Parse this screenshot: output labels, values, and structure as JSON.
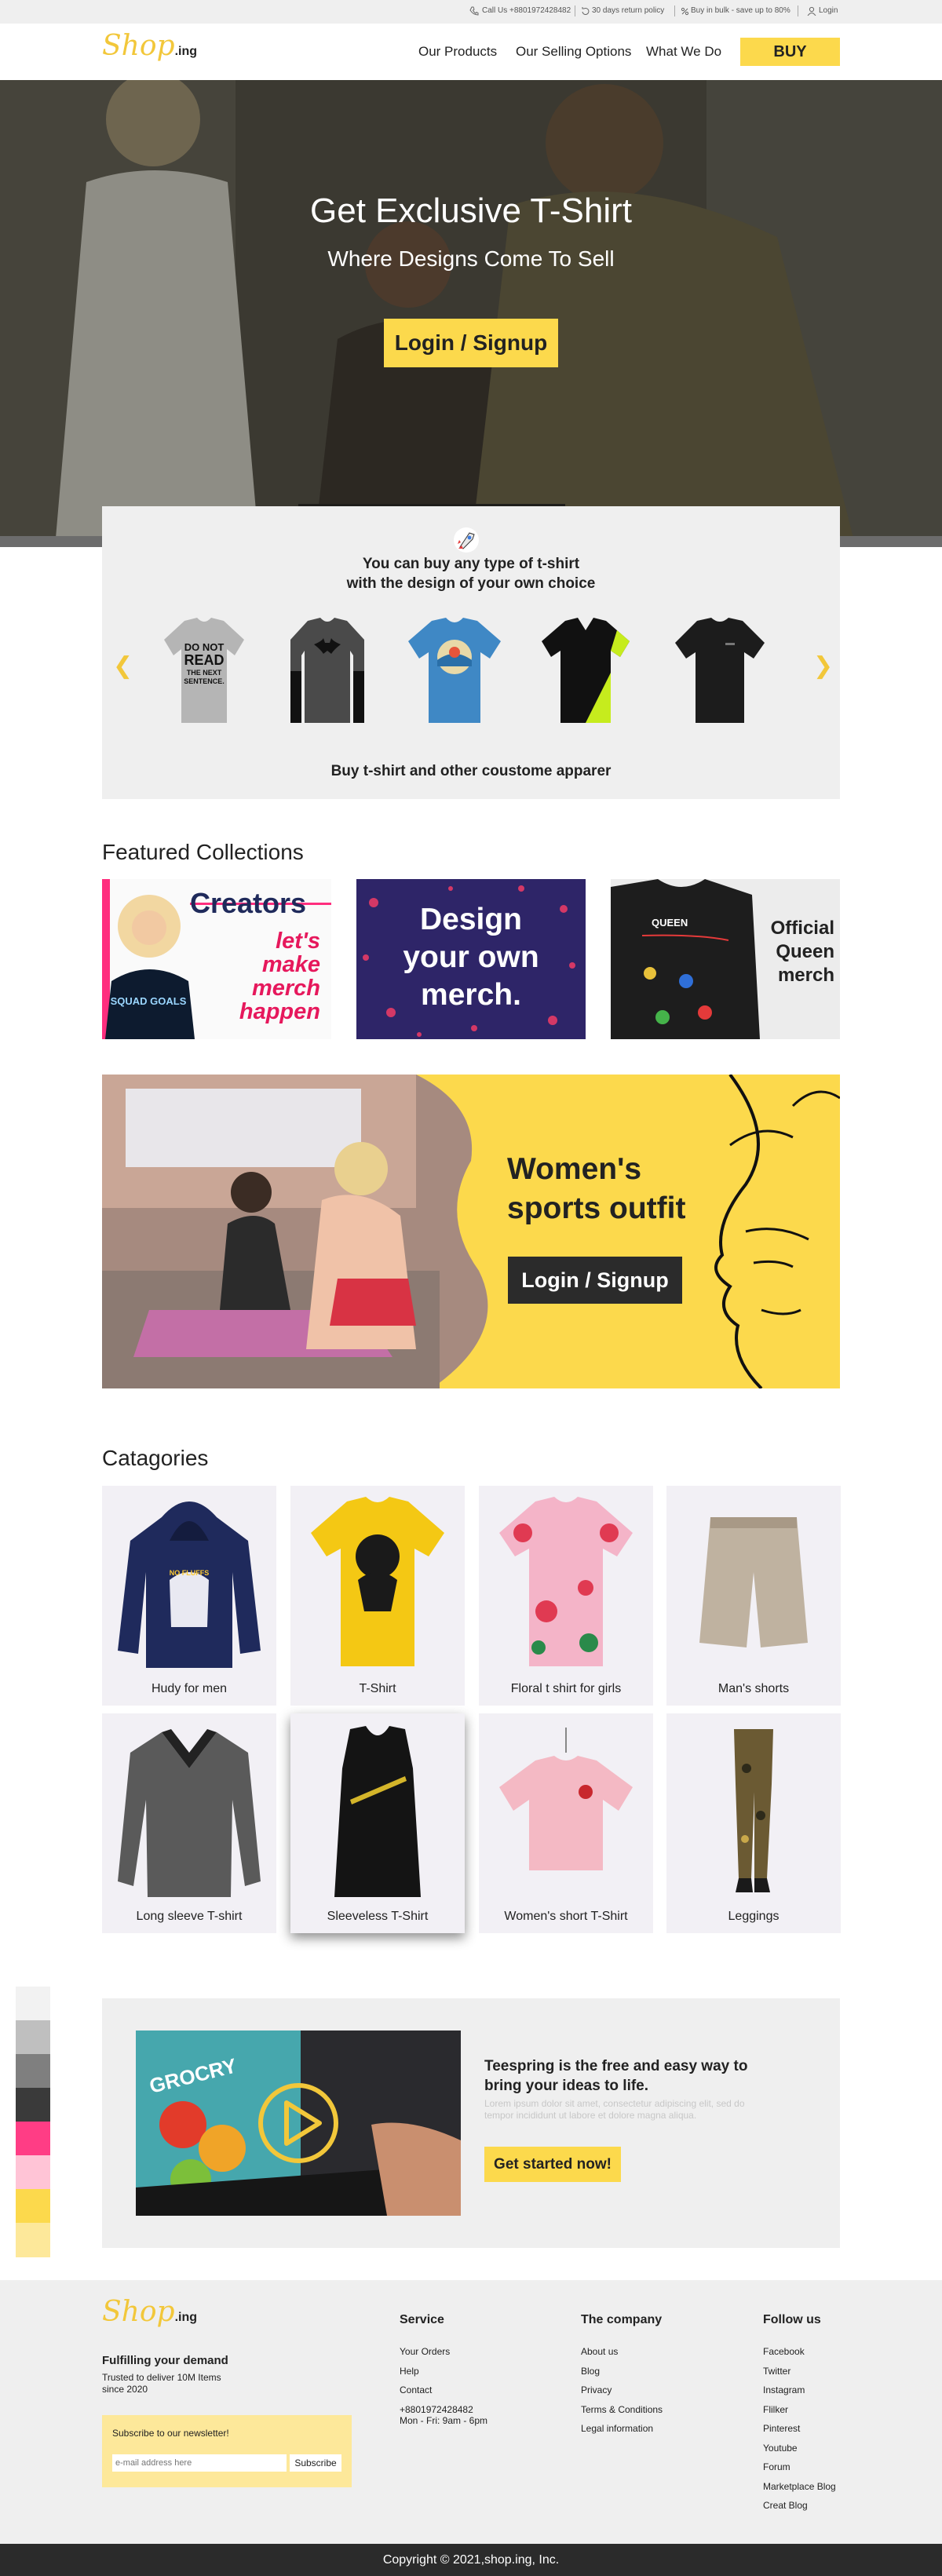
{
  "topbar": {
    "call": "Call Us +8801972428482",
    "returns": "30 days return policy",
    "bulk": "Buy in bulk - save up to 80%",
    "login": "Login"
  },
  "brand": {
    "logo_script": "Shop",
    "logo_suffix": ".ing"
  },
  "nav": {
    "items": [
      "Our Products",
      "Our Selling Options",
      "What We Do"
    ],
    "buy": "BUY"
  },
  "hero": {
    "title": "Get Exclusive T-Shirt",
    "subtitle": "Where Designs Come To Sell",
    "cta": "Login / Signup"
  },
  "showcase": {
    "line1": "You can buy any type of t-shirt",
    "line2": "with the design of your own choice",
    "tee1_text": "DO NOT READ THE NEXT SENTENCE.",
    "caption": "Buy t-shirt and other coustome apparer"
  },
  "featured": {
    "title": "Featured Collections",
    "card1": {
      "heading": "Creators",
      "l1": "let's",
      "l2": "make",
      "l3": "merch",
      "l4": "happen",
      "shirt": "SQUAD GOALS"
    },
    "card2": {
      "l1": "Design",
      "l2": "your own",
      "l3": "merch."
    },
    "card3": {
      "l1": "Official",
      "l2": "Queen",
      "l3": "merch",
      "shirt": "QUEEN"
    }
  },
  "promo": {
    "l1": "Women's",
    "l2": "sports outfit",
    "cta": "Login / Signup"
  },
  "categories": {
    "title": "Catagories",
    "items": [
      "Hudy for men",
      "T-Shirt",
      "Floral t shirt for girls",
      "Man's shorts",
      "Long sleeve T-shirt",
      "Sleeveless T-Shirt",
      "Women's short T-Shirt",
      "Leggings"
    ]
  },
  "video": {
    "thumb_text": "GROCRY",
    "heading1": "Teespring is the free and easy way to",
    "heading2": "bring your ideas to life.",
    "body1": "Lorem ipsum dolor sit amet, consectetur adipiscing elit, sed do",
    "body2": "tempor incididunt ut labore et dolore magna aliqua.",
    "cta": "Get started now!"
  },
  "swatches": [
    "#f2f2f2",
    "#bfbfbf",
    "#7f7f7f",
    "#3a3a3a",
    "#ff3d85",
    "#ffc4d6",
    "#fcd94c",
    "#fde89a"
  ],
  "footer": {
    "tagline": "Fulfilling your demand",
    "sub1": "Trusted to deliver 10M Items",
    "sub2": "since 2020",
    "newsletter": {
      "title": "Subscribe to our newsletter!",
      "placeholder": "e-mail address here",
      "button": "Subscribe"
    },
    "service": {
      "title": "Service",
      "links": [
        "Your Orders",
        "Help",
        "Contact",
        "+8801972428482",
        "Mon - Fri: 9am - 6pm"
      ]
    },
    "company": {
      "title": "The company",
      "links": [
        "About us",
        "Blog",
        "Privacy",
        "Terms & Conditions",
        "Legal information"
      ]
    },
    "follow": {
      "title": "Follow us",
      "links": [
        "Facebook",
        "Twitter",
        "Instagram",
        "Flilker",
        "Pinterest",
        "Youtube",
        "Forum",
        "Marketplace Blog",
        "Creat Blog"
      ]
    }
  },
  "copyright": "Copyright © 2021,shop.ing, Inc."
}
